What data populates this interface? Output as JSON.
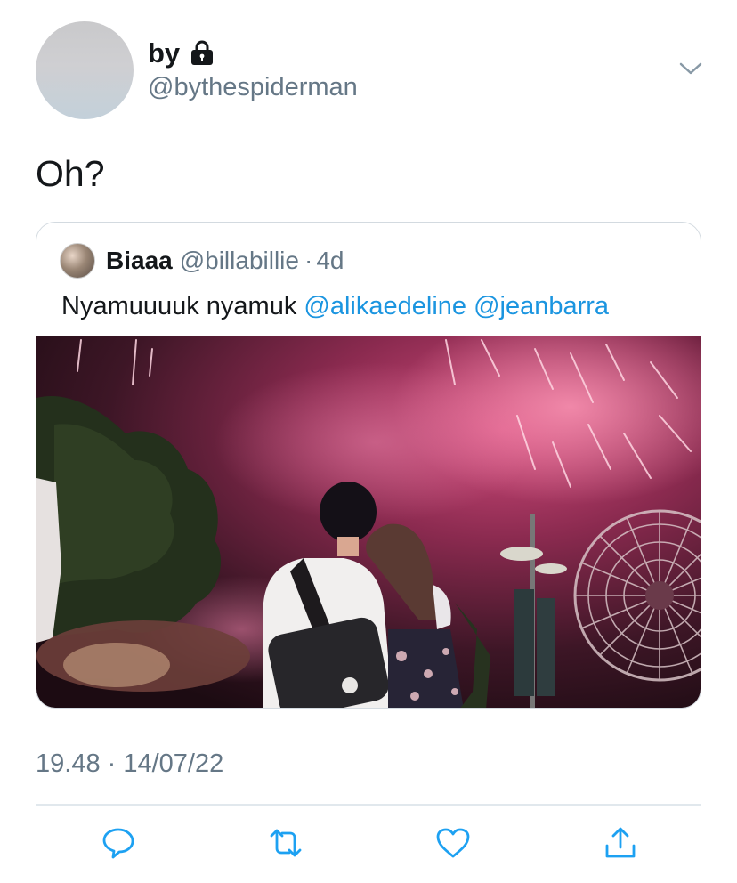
{
  "tweet": {
    "display_name": "by",
    "handle": "@bythespiderman",
    "text": "Oh?",
    "timestamp": "19.48 · 14/07/22"
  },
  "quote": {
    "display_name": "Biaaa",
    "handle": "@billabillie",
    "separator": "·",
    "time": "4d",
    "text_plain": "Nyamuuuuk nyamuk ",
    "mention_1": "@alikaedeline",
    "mention_2": "@jeanbarra"
  },
  "icons": {
    "lock": "lock-icon",
    "chevron": "chevron-down-icon",
    "reply": "reply-icon",
    "retweet": "retweet-icon",
    "like": "heart-icon",
    "share": "share-icon"
  },
  "colors": {
    "link": "#1b95e0",
    "secondary_text": "#657786",
    "icon": "#1da1f2"
  }
}
